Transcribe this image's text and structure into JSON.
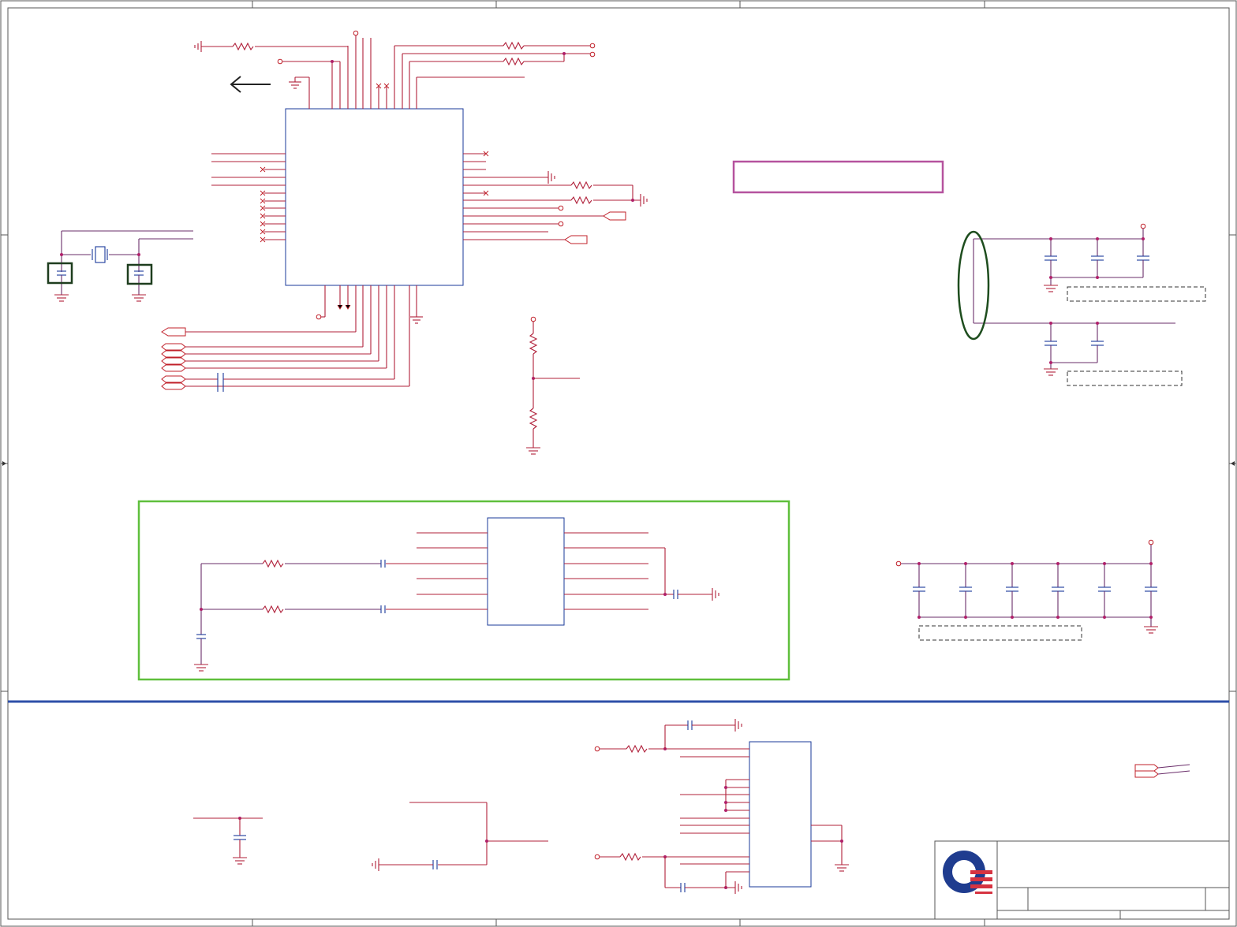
{
  "document": {
    "title_block": {
      "title": "",
      "doc_number": "",
      "revision": "",
      "sheet": ""
    }
  },
  "highlights": {
    "magenta_box": {
      "color": "#b5529e"
    },
    "green_region": {
      "color": "#5fbf3c"
    },
    "ellipse": {
      "color": "#1e4d1e"
    },
    "crystal_caps": {
      "color": "#1e3d1e"
    },
    "divider": {
      "color": "#2e4fa8"
    }
  },
  "logo": {
    "ring_color": "#1f3c8f",
    "stripe_color": "#d63341"
  }
}
